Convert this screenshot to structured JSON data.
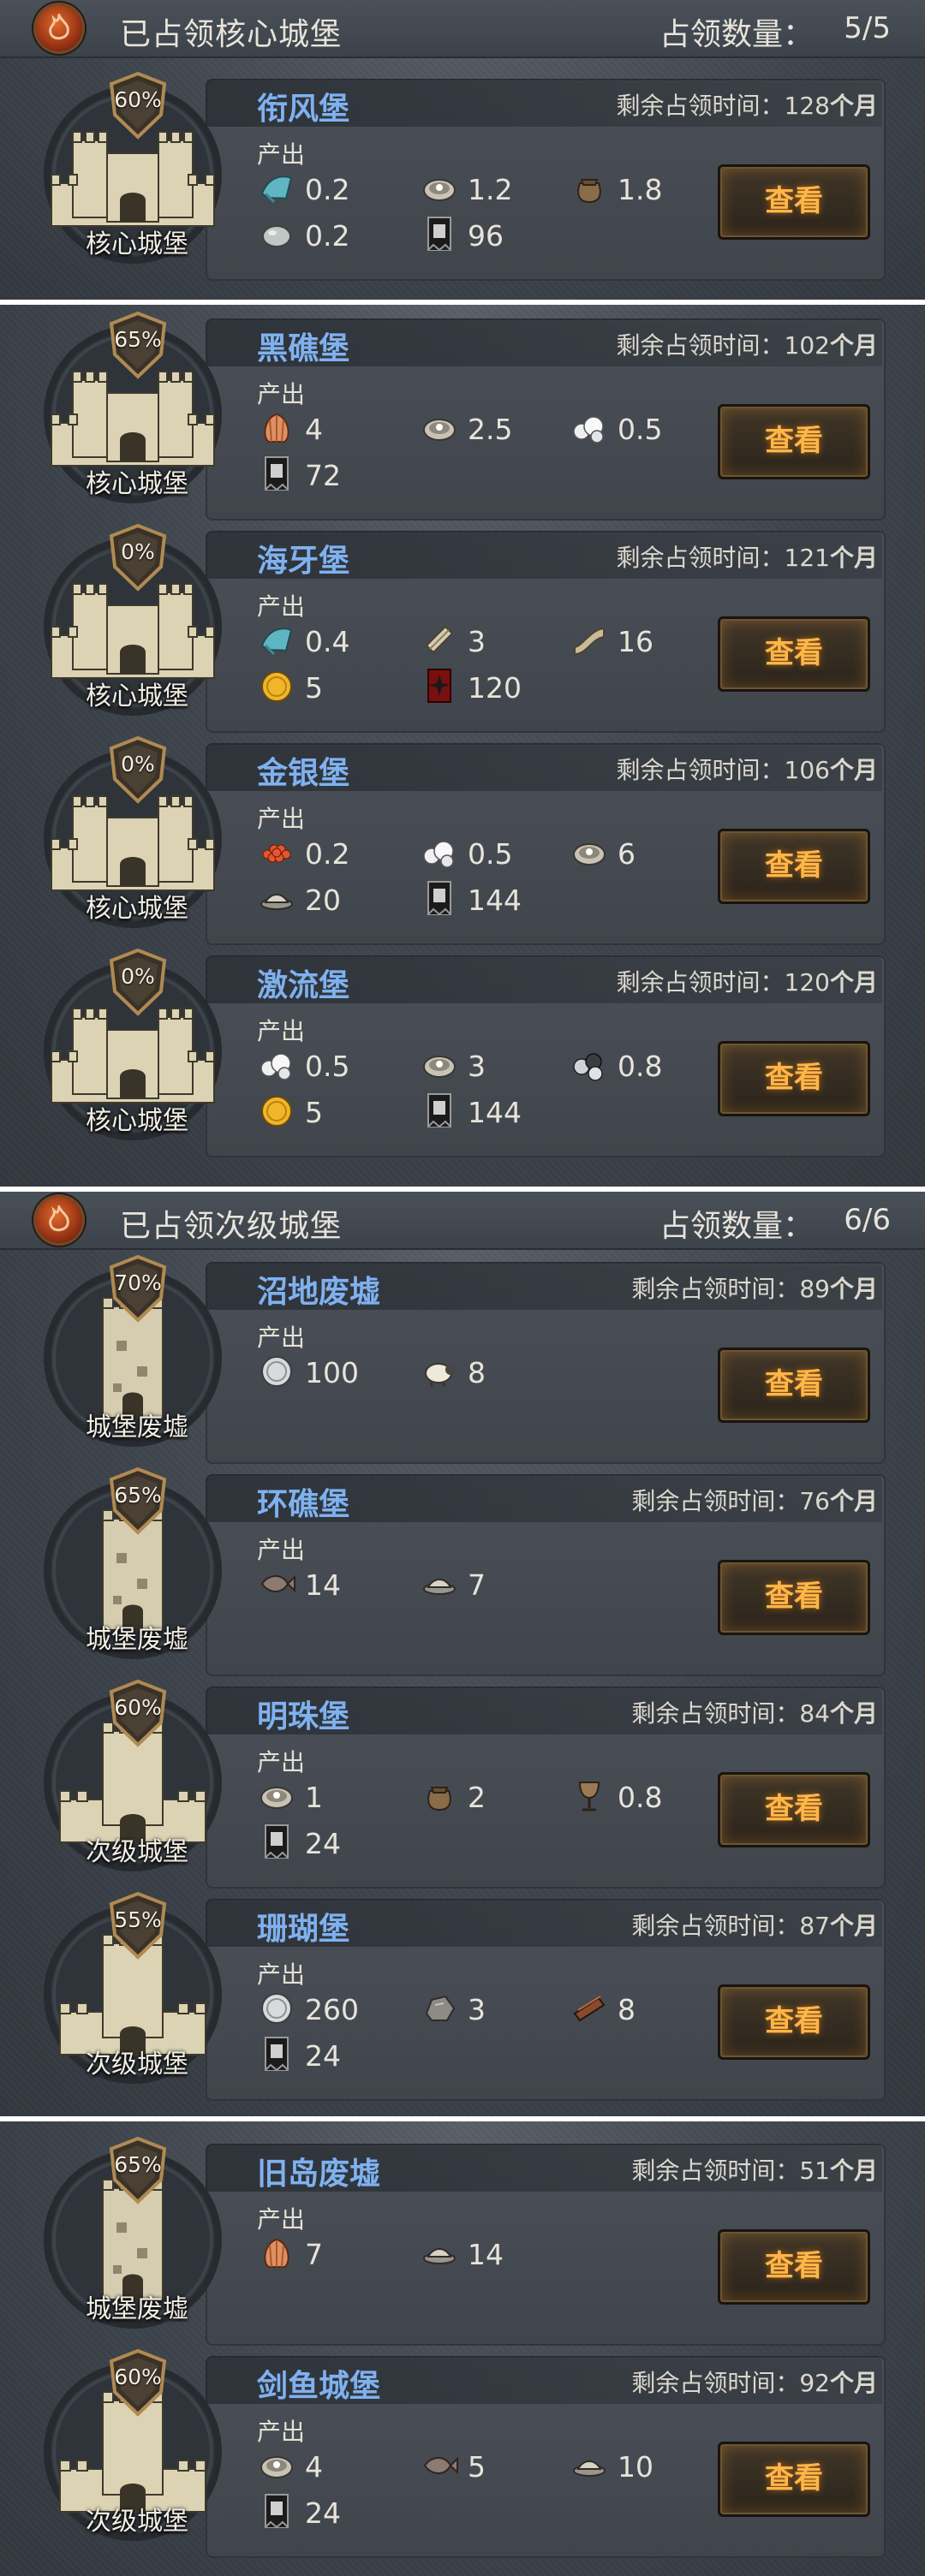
{
  "core_section": {
    "title": "已占领核心城堡",
    "count_label": "占领数量：",
    "count": "5/5"
  },
  "secondary_section": {
    "title": "已占领次级城堡",
    "count_label": "占领数量：",
    "count": "6/6"
  },
  "labels": {
    "produce": "产出",
    "remain": "剩余占领时间：",
    "months": "个月",
    "view": "查看"
  },
  "castles": [
    {
      "name": "衔风堡",
      "type": "核心城堡",
      "percent": "60%",
      "remaining": "128",
      "resources": [
        {
          "icon": "cloth-icon",
          "value": "0.2"
        },
        {
          "icon": "oyster-icon",
          "value": "1.2"
        },
        {
          "icon": "sack-icon",
          "value": "1.8"
        },
        {
          "icon": "stone-icon",
          "value": "0.2"
        },
        {
          "icon": "banner-icon",
          "value": "96"
        }
      ]
    },
    {
      "name": "黑礁堡",
      "type": "核心城堡",
      "percent": "65%",
      "remaining": "102",
      "resources": [
        {
          "icon": "shell-icon",
          "value": "4"
        },
        {
          "icon": "oyster-icon",
          "value": "2.5"
        },
        {
          "icon": "pearl-icon",
          "value": "0.5"
        },
        {
          "icon": "banner-icon",
          "value": "72"
        }
      ]
    },
    {
      "name": "海牙堡",
      "type": "核心城堡",
      "percent": "0%",
      "remaining": "121",
      "resources": [
        {
          "icon": "cloth-icon",
          "value": "0.4"
        },
        {
          "icon": "scroll-icon",
          "value": "3"
        },
        {
          "icon": "parchment-icon",
          "value": "16"
        },
        {
          "icon": "gold-coin-icon",
          "value": "5"
        },
        {
          "icon": "red-banner-icon",
          "value": "120"
        }
      ]
    },
    {
      "name": "金银堡",
      "type": "核心城堡",
      "percent": "0%",
      "remaining": "106",
      "resources": [
        {
          "icon": "roe-icon",
          "value": "0.2"
        },
        {
          "icon": "pearl-icon",
          "value": "0.5"
        },
        {
          "icon": "oyster-icon",
          "value": "6"
        },
        {
          "icon": "fish-dish-icon",
          "value": "20"
        },
        {
          "icon": "banner-icon",
          "value": "144"
        }
      ]
    },
    {
      "name": "激流堡",
      "type": "核心城堡",
      "percent": "0%",
      "remaining": "120",
      "resources": [
        {
          "icon": "pearl-icon",
          "value": "0.5"
        },
        {
          "icon": "oyster-icon",
          "value": "3"
        },
        {
          "icon": "black-pearl-icon",
          "value": "0.8"
        },
        {
          "icon": "gold-coin-icon",
          "value": "5"
        },
        {
          "icon": "banner-icon",
          "value": "144"
        }
      ]
    },
    {
      "name": "沼地废墟",
      "type": "城堡废墟",
      "percent": "70%",
      "remaining": "89",
      "resources": [
        {
          "icon": "silver-coin-icon",
          "value": "100"
        },
        {
          "icon": "sheep-icon",
          "value": "8"
        }
      ]
    },
    {
      "name": "环礁堡",
      "type": "城堡废墟",
      "percent": "65%",
      "remaining": "76",
      "resources": [
        {
          "icon": "fish-icon",
          "value": "14"
        },
        {
          "icon": "fish-dish-icon",
          "value": "7"
        }
      ]
    },
    {
      "name": "明珠堡",
      "type": "次级城堡",
      "percent": "60%",
      "remaining": "84",
      "resources": [
        {
          "icon": "oyster-icon",
          "value": "1"
        },
        {
          "icon": "sack-icon",
          "value": "2"
        },
        {
          "icon": "goblet-icon",
          "value": "0.8"
        },
        {
          "icon": "banner-icon",
          "value": "24"
        }
      ]
    },
    {
      "name": "珊瑚堡",
      "type": "次级城堡",
      "percent": "55%",
      "remaining": "87",
      "resources": [
        {
          "icon": "silver-coin-icon",
          "value": "260"
        },
        {
          "icon": "ore-icon",
          "value": "3"
        },
        {
          "icon": "wood-plank-icon",
          "value": "8"
        },
        {
          "icon": "banner-icon",
          "value": "24"
        }
      ]
    },
    {
      "name": "旧岛废墟",
      "type": "城堡废墟",
      "percent": "65%",
      "remaining": "51",
      "resources": [
        {
          "icon": "shell-icon",
          "value": "7"
        },
        {
          "icon": "fish-dish-icon",
          "value": "14"
        }
      ]
    },
    {
      "name": "剑鱼城堡",
      "type": "次级城堡",
      "percent": "60%",
      "remaining": "92",
      "resources": [
        {
          "icon": "oyster-icon",
          "value": "4"
        },
        {
          "icon": "fish-icon",
          "value": "5"
        },
        {
          "icon": "fish-dish-icon",
          "value": "10"
        },
        {
          "icon": "banner-icon",
          "value": "24"
        }
      ]
    }
  ]
}
